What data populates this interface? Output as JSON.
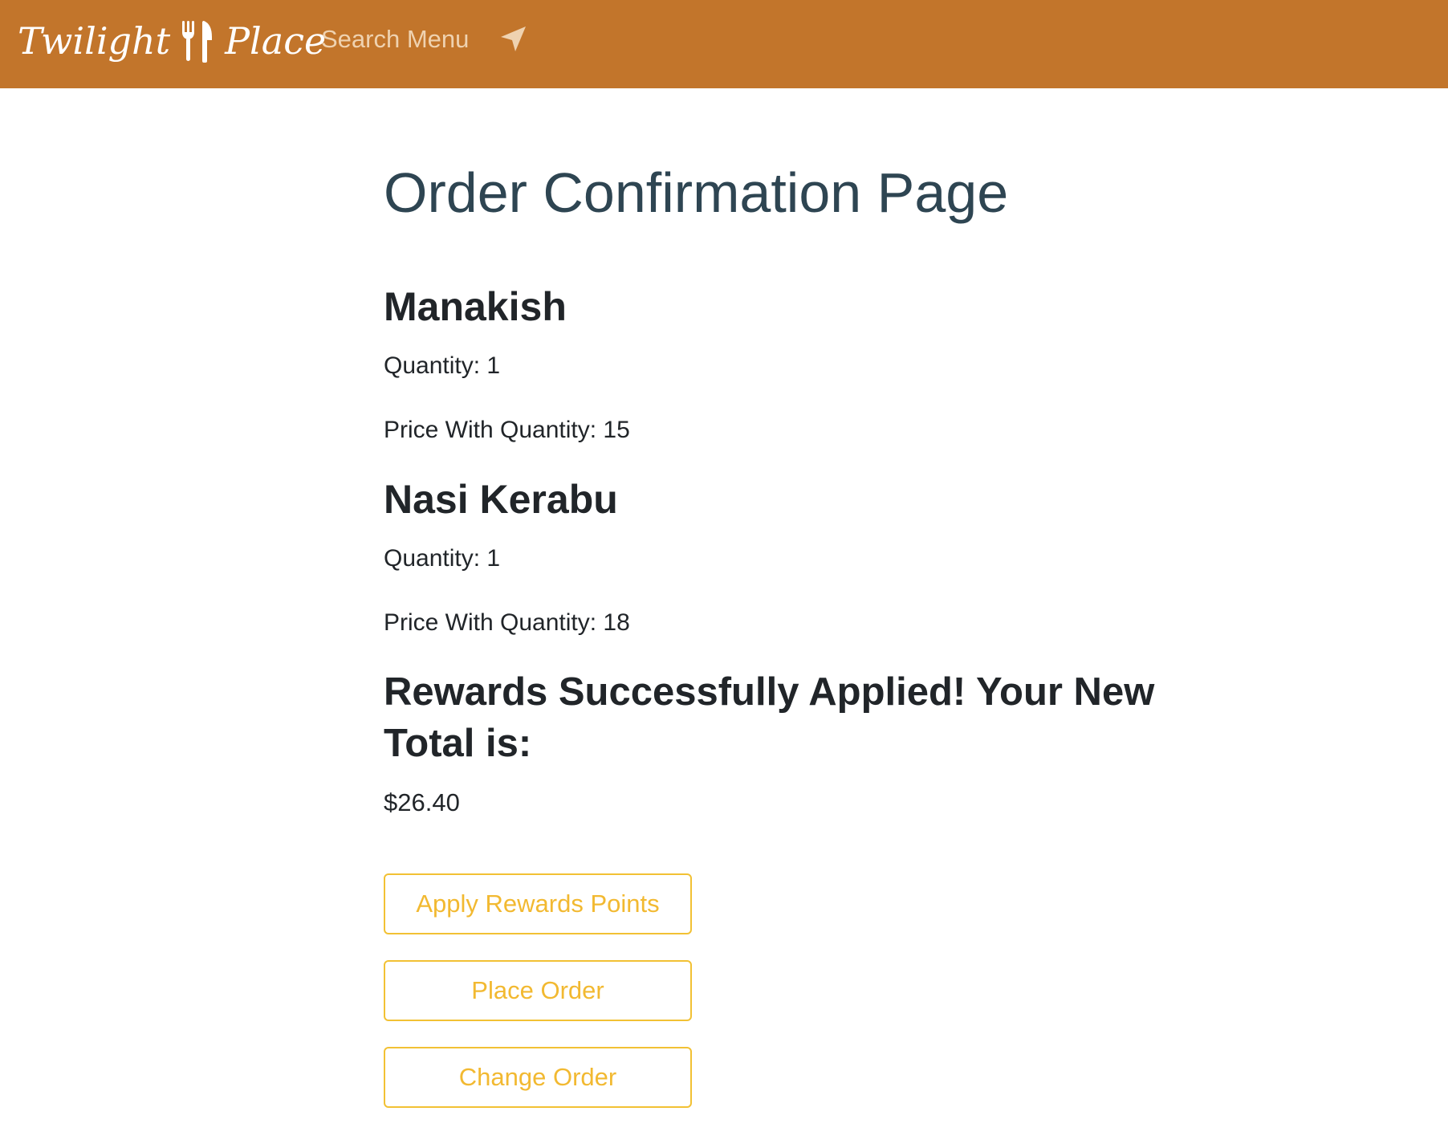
{
  "navbar": {
    "brand_left": "Twilight",
    "brand_right": "Place",
    "brand_icon": "fork-knife-icon",
    "search_label": "Search Menu",
    "search_icon": "location-arrow-icon",
    "background_color": "#c2752b"
  },
  "page": {
    "title": "Order Confirmation Page"
  },
  "order_items": [
    {
      "name": "Manakish",
      "quantity_text": "Quantity: 1",
      "price_text": "Price With Quantity: 15"
    },
    {
      "name": "Nasi Kerabu",
      "quantity_text": "Quantity: 1",
      "price_text": "Price With Quantity: 18"
    }
  ],
  "rewards": {
    "message": "Rewards Successfully Applied! Your New Total is:",
    "new_total": "$26.40"
  },
  "actions": {
    "apply_rewards_label": "Apply Rewards Points",
    "place_order_label": "Place Order",
    "change_order_label": "Change Order",
    "accent_color": "#f2c134"
  }
}
